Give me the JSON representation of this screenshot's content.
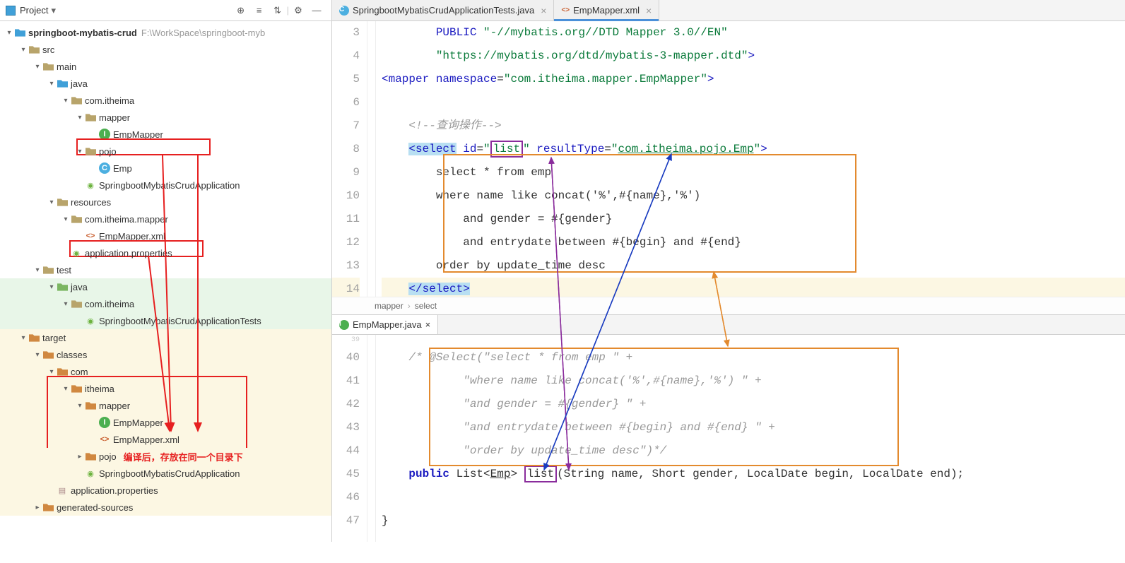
{
  "sidebar": {
    "title": "Project",
    "project_name": "springboot-mybatis-crud",
    "project_path": "F:\\WorkSpace\\springboot-myb",
    "tree": {
      "src": "src",
      "main": "main",
      "java": "java",
      "com_itheima": "com.itheima",
      "mapper": "mapper",
      "emp_mapper": "EmpMapper",
      "pojo": "pojo",
      "emp": "Emp",
      "app_main": "SpringbootMybatisCrudApplication",
      "resources": "resources",
      "com_itheima_mapper": "com.itheima.mapper",
      "emp_mapper_xml": "EmpMapper.xml",
      "app_props": "application.properties",
      "test": "test",
      "test_java": "java",
      "test_com_itheima": "com.itheima",
      "app_tests": "SpringbootMybatisCrudApplicationTests",
      "target": "target",
      "classes": "classes",
      "com": "com",
      "itheima": "itheima",
      "mapper2": "mapper",
      "emp_mapper2": "EmpMapper",
      "emp_mapper_xml2": "EmpMapper.xml",
      "pojo2": "pojo",
      "red_note": "编译后，存放在同一个目录下",
      "app_main2": "SpringbootMybatisCrudApplication",
      "app_props2": "application.properties",
      "generated_sources": "generated-sources"
    }
  },
  "tabs": {
    "tests_tab": "SpringbootMybatisCrudApplicationTests.java",
    "xml_tab": "EmpMapper.xml",
    "java_tab": "EmpMapper.java"
  },
  "editor": {
    "line3": "PUBLIC \"-//mybatis.org//DTD Mapper 3.0//EN\"",
    "line4": "\"https://mybatis.org/dtd/mybatis-3-mapper.dtd\">",
    "comment": "<!--查询操作-->",
    "id_value": "list",
    "result_type": "com.itheima.pojo.Emp",
    "sql_line1": "select * from emp",
    "sql_line2": "where name like concat('%',#{name},'%')",
    "sql_line3": "    and gender = #{gender}",
    "sql_line4": "    and entrydate between #{begin} and #{end}",
    "sql_line5": "order by update_time desc",
    "namespace": "com.itheima.mapper.EmpMapper"
  },
  "breadcrumb": {
    "p1": "mapper",
    "p2": "select"
  },
  "java_editor": {
    "line40": "/* @Select(\"select * from emp \" +",
    "line41": "        \"where name like concat('%',#{name},'%') \" +",
    "line42": "        \"and gender = #{gender} \" +",
    "line43": "        \"and entrydate between #{begin} and #{end} \" +",
    "line44": "        \"order by update_time desc\")*/",
    "sig_public": "public",
    "sig_list": "List",
    "sig_emp": "Emp",
    "sig_method": "list",
    "sig_params": "(String name, Short gender, LocalDate begin, LocalDate end);",
    "line47": "}"
  }
}
